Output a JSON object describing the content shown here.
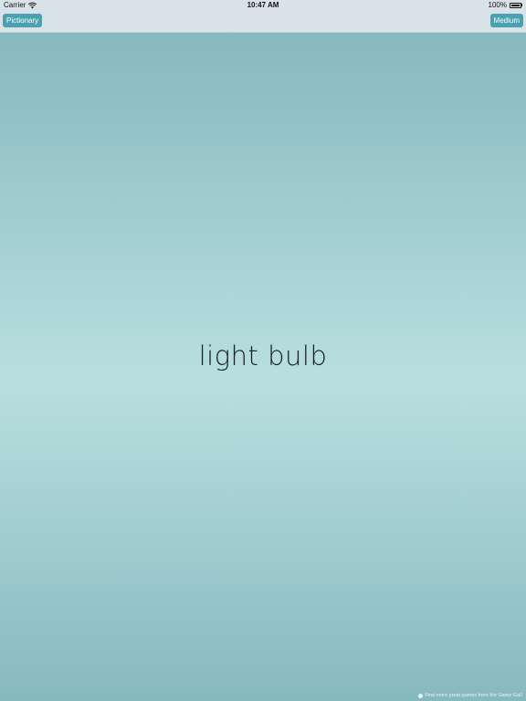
{
  "status_bar": {
    "carrier": "Carrier",
    "time": "10:47 AM",
    "battery": "100%",
    "battery_level": 1.0
  },
  "nav": {
    "left_button": "Pictionary",
    "right_button": "Medium",
    "accent_color": "#4aa2b0"
  },
  "main": {
    "word": "light bulb",
    "footer_link": "Find more great games from the Game Gal!"
  },
  "icons": {
    "wifi": "wifi-icon",
    "battery": "battery-icon",
    "info": "info-icon"
  }
}
